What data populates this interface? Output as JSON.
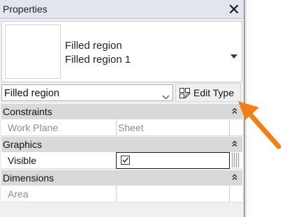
{
  "panel": {
    "title": "Properties",
    "close_icon": "close-icon"
  },
  "type_selector": {
    "family": "Filled region",
    "type_name": "Filled region 1"
  },
  "instance_filter": {
    "selected": "Filled region"
  },
  "edit_type_button": {
    "label": "Edit Type",
    "icon": "edit-type-icon"
  },
  "categories": [
    {
      "label": "Constraints",
      "rows": [
        {
          "label": "Work Plane",
          "value": "Sheet",
          "editable": false
        }
      ]
    },
    {
      "label": "Graphics",
      "rows": [
        {
          "label": "Visible",
          "value_checked": true,
          "editable": true
        }
      ]
    },
    {
      "label": "Dimensions",
      "rows": [
        {
          "label": "Area",
          "value": "",
          "editable": false
        }
      ]
    }
  ],
  "annotation": {
    "arrow_color": "#f07f1a",
    "points_to": "edit-type-button"
  },
  "colors": {
    "panel_bg": "#f0f0f0",
    "category_bg": "#d9d9d9",
    "arrow": "#f07f1a"
  }
}
